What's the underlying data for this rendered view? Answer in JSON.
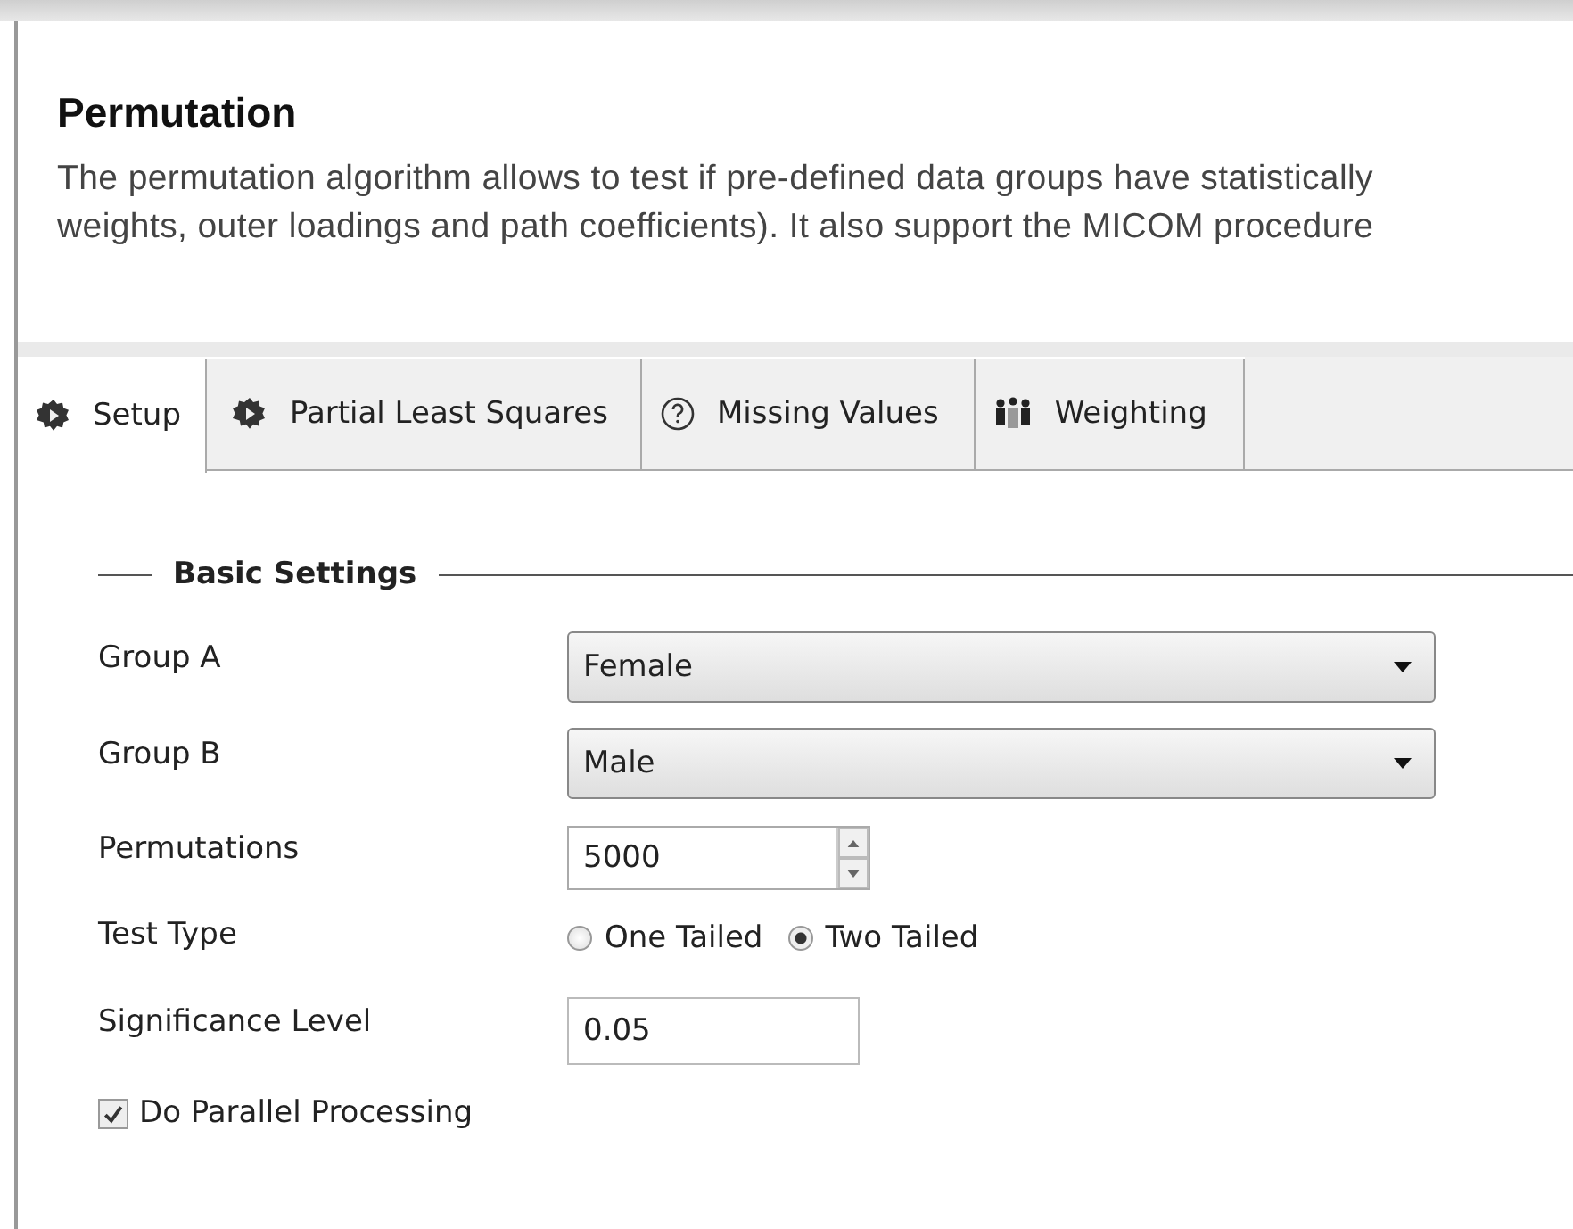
{
  "header": {
    "title": "Permutation",
    "description_lines": [
      "The permutation algorithm allows to test if pre-defined data groups have statistically",
      "weights, outer loadings and path coefficients). It also support the MICOM procedure"
    ]
  },
  "tabs": [
    {
      "label": "Setup",
      "kind": "gear",
      "selected": true
    },
    {
      "label": "Partial Least Squares",
      "kind": "gear",
      "selected": false
    },
    {
      "label": "Missing Values",
      "kind": "help",
      "selected": false
    },
    {
      "label": "Weighting",
      "kind": "people",
      "selected": false
    }
  ],
  "section": {
    "title": "Basic Settings"
  },
  "fields": [
    {
      "kind": "dropdown",
      "label": "Group A",
      "value": "Female"
    },
    {
      "kind": "dropdown",
      "label": "Group B",
      "value": "Male"
    },
    {
      "kind": "spinner",
      "label": "Permutations",
      "value": "5000"
    },
    {
      "kind": "radio",
      "label": "Test Type",
      "options": [
        {
          "label": "One Tailed",
          "selected": false
        },
        {
          "label": "Two Tailed",
          "selected": true
        }
      ]
    },
    {
      "kind": "text",
      "label": "Significance Level",
      "value": "0.05"
    }
  ],
  "checkbox": {
    "label": "Do Parallel Processing",
    "checked": true
  }
}
